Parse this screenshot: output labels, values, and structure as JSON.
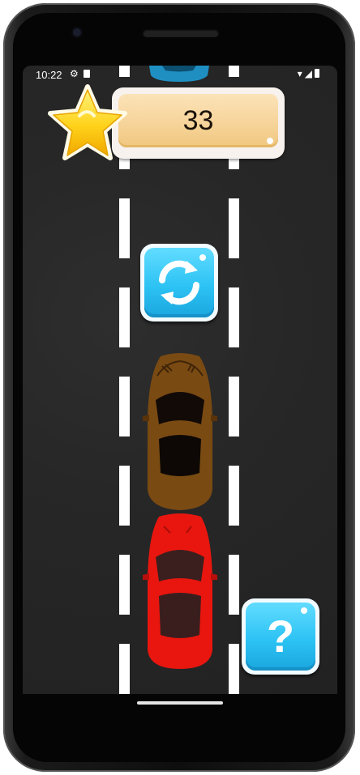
{
  "status_bar": {
    "time": "10:22",
    "left_icons": [
      "settings-icon",
      "sd-card-icon"
    ],
    "right_icons": [
      "wifi-icon",
      "signal-icon",
      "battery-icon"
    ]
  },
  "score": {
    "value": "33",
    "icon": "star-icon"
  },
  "buttons": {
    "restart_icon": "refresh-icon",
    "help_glyph": "?"
  },
  "cars": [
    {
      "name": "player-car",
      "color": "#e8160f"
    },
    {
      "name": "opponent-car",
      "color": "#7a4a13"
    },
    {
      "name": "top-car",
      "color": "#1f8fc2"
    }
  ],
  "colors": {
    "road": "#272727",
    "lane_marking": "#ffffff",
    "button_blue": "#2dc3f4",
    "score_bg": "#f6d49a"
  }
}
